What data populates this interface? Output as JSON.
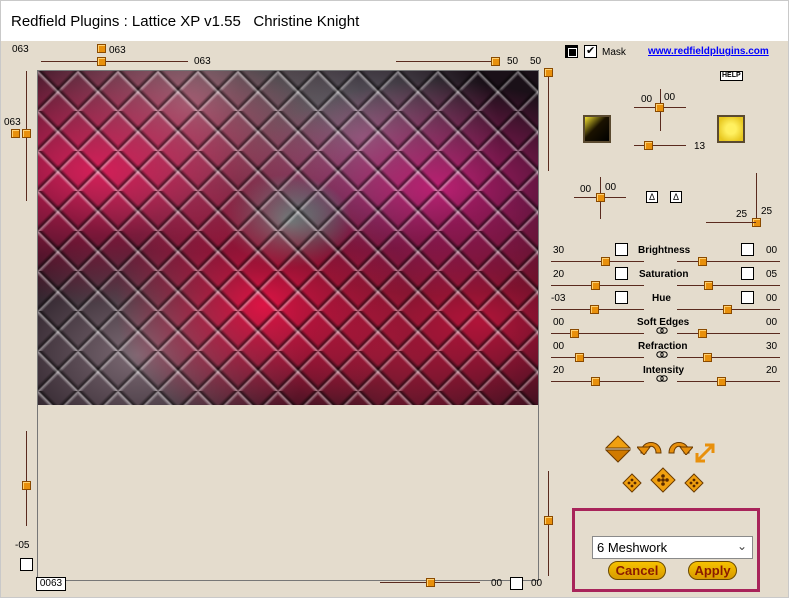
{
  "window": {
    "title": "Redfield Plugins : Lattice XP v1.55   Christine Knight"
  },
  "top_controls": {
    "left_value": "063",
    "top_knob_label": "063",
    "top_slider_value": "063",
    "right_slider_value": "50",
    "right_vertical_value": "50",
    "left_vertical_value": "063"
  },
  "mask": {
    "label": "Mask",
    "checked": true
  },
  "link": "www.redfieldplugins.com",
  "help_label": "HELP",
  "light": {
    "left_value": "00",
    "right_value": "00",
    "bottom_value": "13",
    "colors": {
      "left_swatch": "#1a1200",
      "right_swatch": "#f2e030"
    }
  },
  "direction": {
    "left_value": "00",
    "right_value": "00",
    "button_a": "Δ",
    "button_b": "Δ"
  },
  "depth": {
    "vertical_value": "25",
    "horizontal_value": "25"
  },
  "sliders": [
    {
      "left": "30",
      "label": "Brightness",
      "right": "00"
    },
    {
      "left": "20",
      "label": "Saturation",
      "right": "05"
    },
    {
      "left": "-03",
      "label": "Hue",
      "right": "00"
    },
    {
      "left": "00",
      "label": "Soft Edges",
      "right": "00"
    },
    {
      "left": "00",
      "label": "Refraction",
      "right": "30"
    },
    {
      "left": "20",
      "label": "Intensity",
      "right": "20"
    }
  ],
  "preview": {
    "bottom_left_value": "-05",
    "value_box": "0063",
    "bottom_value_a": "00",
    "bottom_value_b": "00"
  },
  "action_icons": [
    "diamond-up-down-icon",
    "rotate-left-icon",
    "rotate-right-icon",
    "expand-arrow-icon",
    "dice-icon",
    "dice-icon",
    "dice-icon"
  ],
  "pattern": {
    "selected": "6 Meshwork"
  },
  "buttons": {
    "cancel": "Cancel",
    "apply": "Apply"
  }
}
